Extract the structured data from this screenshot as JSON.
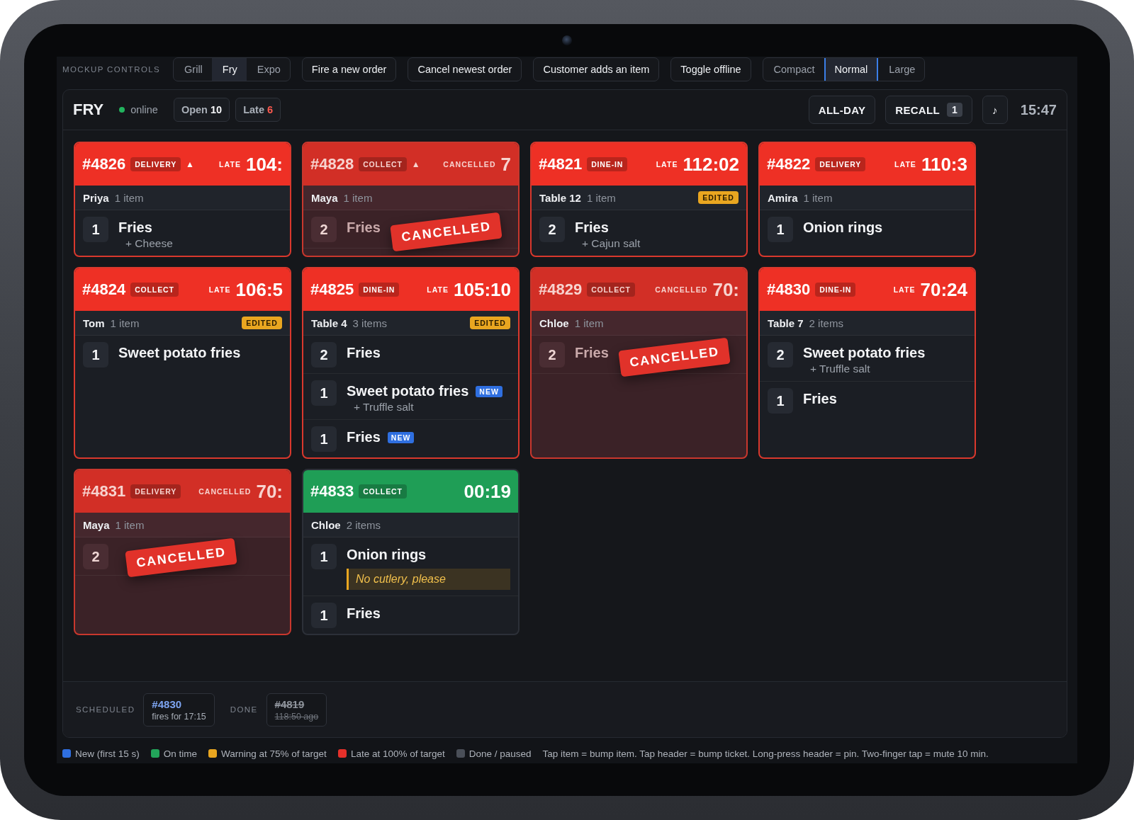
{
  "controls": {
    "label": "MOCKUP CONTROLS",
    "stations": [
      {
        "label": "Grill",
        "selected": false
      },
      {
        "label": "Fry",
        "selected": true
      },
      {
        "label": "Expo",
        "selected": false
      }
    ],
    "actions": [
      "Fire a new order",
      "Cancel newest order",
      "Customer adds an item",
      "Toggle offline"
    ],
    "density": [
      {
        "label": "Compact",
        "selected": false
      },
      {
        "label": "Normal",
        "selected": true
      },
      {
        "label": "Large",
        "selected": false
      }
    ]
  },
  "station": {
    "name": "FRY",
    "online": true,
    "status": "online",
    "counters": [
      {
        "label": "Open",
        "value": "10",
        "alert": false
      },
      {
        "label": "Late",
        "value": "6",
        "alert": true
      }
    ],
    "all_day": "ALL-DAY",
    "recall": {
      "label": "RECALL",
      "count": "1"
    },
    "sound": "♪",
    "clock": "15:47"
  },
  "tickets": [
    {
      "number": "#4826",
      "type": "DELIVERY",
      "kind": "late",
      "alert": "▲",
      "status": "LATE",
      "timer": "104:",
      "customer": "Priya",
      "count": "1 item",
      "items": [
        {
          "qty": "1",
          "name": "Fries",
          "modifier": "+ Cheese"
        }
      ]
    },
    {
      "number": "#4828",
      "type": "COLLECT",
      "kind": "cancelled",
      "alert": "▲",
      "status": "CANCELLED",
      "timer": "7",
      "stamp": "CANCELLED",
      "customer": "Maya",
      "count": "1 item",
      "items": [
        {
          "qty": "2",
          "name": "Fries"
        }
      ]
    },
    {
      "number": "#4821",
      "type": "DINE-IN",
      "kind": "late",
      "status": "LATE",
      "timer": "112:02",
      "customer": "Table 12",
      "count": "1 item",
      "edited": true,
      "edited_label": "EDITED",
      "items": [
        {
          "qty": "2",
          "name": "Fries",
          "modifier": "+ Cajun salt"
        }
      ]
    },
    {
      "number": "#4822",
      "type": "DELIVERY",
      "kind": "late",
      "status": "LATE",
      "timer": "110:3",
      "customer": "Amira",
      "count": "1 item",
      "items": [
        {
          "qty": "1",
          "name": "Onion rings"
        }
      ]
    },
    {
      "number": "#4824",
      "type": "COLLECT",
      "kind": "late",
      "status": "LATE",
      "timer": "106:5",
      "customer": "Tom",
      "count": "1 item",
      "edited": true,
      "edited_label": "EDITED",
      "items": [
        {
          "qty": "1",
          "name": "Sweet potato fries"
        }
      ]
    },
    {
      "number": "#4825",
      "type": "DINE-IN",
      "kind": "late",
      "status": "LATE",
      "timer": "105:10",
      "customer": "Table 4",
      "count": "3 items",
      "edited": true,
      "edited_label": "EDITED",
      "items": [
        {
          "qty": "2",
          "name": "Fries"
        },
        {
          "qty": "1",
          "name": "Sweet potato fries",
          "modifier": "+ Truffle salt",
          "new": true,
          "new_label": "NEW"
        },
        {
          "qty": "1",
          "name": "Fries",
          "new": true,
          "new_label": "NEW"
        }
      ]
    },
    {
      "number": "#4829",
      "type": "COLLECT",
      "kind": "cancelled",
      "status": "CANCELLED",
      "timer": "70:",
      "stamp": "CANCELLED",
      "customer": "Chloe",
      "count": "1 item",
      "items": [
        {
          "qty": "2",
          "name": "Fries"
        }
      ]
    },
    {
      "number": "#4830",
      "type": "DINE-IN",
      "kind": "late",
      "status": "LATE",
      "timer": "70:24",
      "customer": "Table 7",
      "count": "2 items",
      "items": [
        {
          "qty": "2",
          "name": "Sweet potato fries",
          "modifier": "+ Truffle salt"
        },
        {
          "qty": "1",
          "name": "Fries"
        }
      ]
    },
    {
      "number": "#4831",
      "type": "DELIVERY",
      "kind": "cancelled",
      "status": "CANCELLED",
      "timer": "70:",
      "stamp": "CANCELLED",
      "customer": "Maya",
      "count": "1 item",
      "items": [
        {
          "qty": "2"
        }
      ]
    },
    {
      "number": "#4833",
      "type": "COLLECT",
      "kind": "on_time",
      "timer": "00:19",
      "customer": "Chloe",
      "count": "2 items",
      "items": [
        {
          "qty": "1",
          "name": "Onion rings",
          "note": "No cutlery, please"
        },
        {
          "qty": "1",
          "name": "Fries"
        }
      ]
    }
  ],
  "footer": {
    "scheduled": {
      "label": "SCHEDULED",
      "orders": [
        {
          "number": "#4830",
          "detail": "fires for 17:15"
        }
      ]
    },
    "done": {
      "label": "DONE",
      "orders": [
        {
          "number": "#4819",
          "detail": "118:50 ago"
        }
      ]
    }
  },
  "legend": [
    {
      "label": "New (first 15 s)",
      "color": "#2f6fe0"
    },
    {
      "label": "On time",
      "color": "#22a55a"
    },
    {
      "label": "Warning at 75% of target",
      "color": "#e9a620"
    },
    {
      "label": "Late at 100% of target",
      "color": "#e5302a"
    },
    {
      "label": "Done / paused",
      "color": "#4a4f58"
    }
  ],
  "hint": "Tap item = bump item. Tap header = bump ticket. Long-press header = pin. Two-finger tap = mute 10 min."
}
